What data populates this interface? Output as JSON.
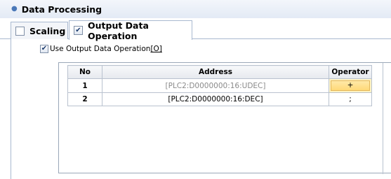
{
  "section": {
    "title": "Data Processing",
    "bullet_color": "#4a78b8"
  },
  "tabs": [
    {
      "label": "Scaling",
      "checked": false,
      "selected": false
    },
    {
      "label": "Output Data Operation",
      "checked": true,
      "selected": true
    }
  ],
  "options": {
    "use_output_operation": {
      "checked": true,
      "label_prefix": "Use Output Data Operation",
      "label_hotkey": "[O]"
    }
  },
  "grid": {
    "columns": [
      "No",
      "Address",
      "Operator"
    ],
    "rows": [
      {
        "no": "1",
        "address": "[PLC2:D0000000:16:UDEC]",
        "operator": "+"
      },
      {
        "no": "2",
        "address": "[PLC2:D0000000:16:DEC]",
        "operator": ";"
      }
    ]
  },
  "colors": {
    "header_blue": "#4a78b8",
    "selection_yellow": "#ffd978"
  }
}
